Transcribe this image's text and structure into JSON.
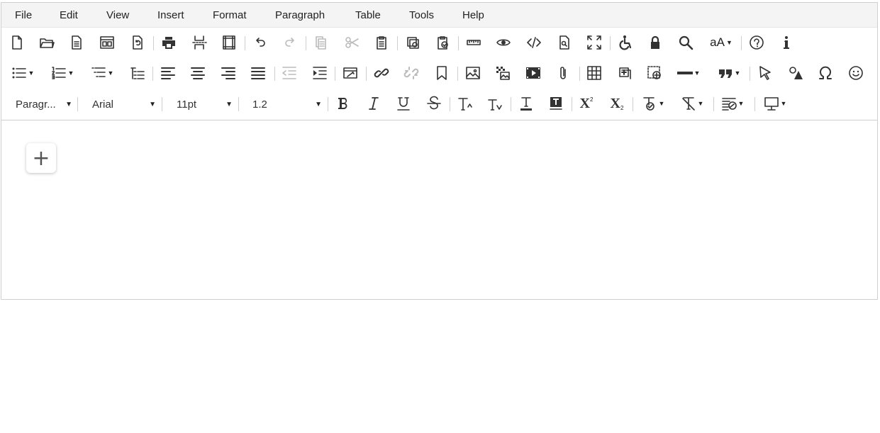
{
  "menu": [
    "File",
    "Edit",
    "View",
    "Insert",
    "Format",
    "Paragraph",
    "Table",
    "Tools",
    "Help"
  ],
  "toolbar3": {
    "block_format": "Paragr...",
    "font_family": "Arial",
    "font_size": "11pt",
    "line_height": "1.2",
    "font_size_label": "aA"
  },
  "icons": {
    "row1": [
      "new-document-icon",
      "open-folder-icon",
      "template-icon",
      "layout-icon",
      "restore-draft-icon",
      "print-icon",
      "page-break-icon",
      "page-border-icon",
      "undo-icon",
      "redo-icon",
      "copy-icon",
      "cut-icon",
      "paste-icon",
      "paste-special-icon",
      "paste-text-icon",
      "ruler-icon",
      "preview-icon",
      "source-code-icon",
      "find-doc-icon",
      "fullscreen-icon",
      "accessibility-icon",
      "lock-icon",
      "search-icon",
      "font-size-icon",
      "help-icon",
      "info-icon"
    ],
    "row2": [
      "bullet-list-icon",
      "numbered-list-icon",
      "multilevel-list-icon",
      "outline-icon",
      "align-left-icon",
      "align-center-icon",
      "align-right-icon",
      "justify-icon",
      "outdent-icon",
      "indent-icon",
      "format-paint-icon",
      "link-icon",
      "unlink-icon",
      "bookmark-icon",
      "image-icon",
      "image-gallery-icon",
      "video-icon",
      "attachment-icon",
      "table-icon",
      "insert-box-icon",
      "insert-frame-icon",
      "horizontal-rule-icon",
      "blockquote-icon",
      "select-icon",
      "shapes-icon",
      "omega-icon",
      "emoji-icon"
    ],
    "row3": [
      "bold-icon",
      "italic-icon",
      "underline-icon",
      "strikethrough-icon",
      "increase-font-icon",
      "decrease-font-icon",
      "text-color-icon",
      "highlight-icon",
      "superscript-icon",
      "subscript-icon",
      "format-painter-icon",
      "clear-formatting-icon",
      "styles-icon",
      "monitor-icon"
    ]
  },
  "editor": {
    "add_button": "+"
  }
}
